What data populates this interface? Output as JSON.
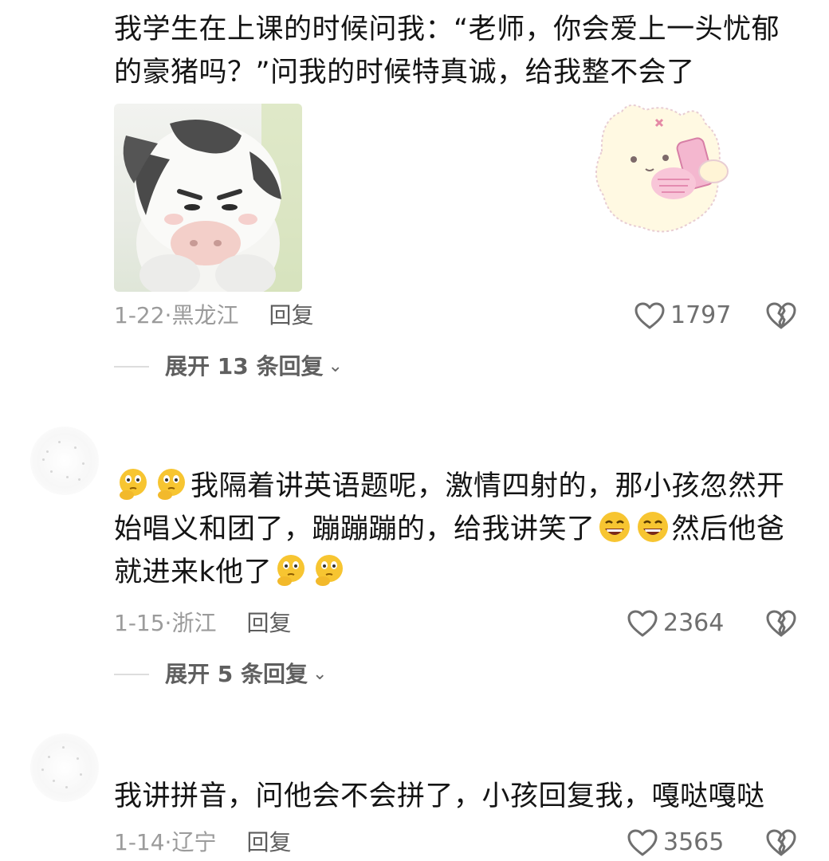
{
  "comments": [
    {
      "text": "我学生在上课的时候问我：“老师，你会爱上一头忧郁的豪猪吗？”问我的时候特真诚，给我整不会了",
      "date": "1-22",
      "location": "黑龙江",
      "reply_label": "回复",
      "likes": "1797",
      "expand_label": "展开 13 条回复"
    },
    {
      "text_seg1": "我隔着讲英语题呢，激情四射的，那小孩忽然开始唱义和团了，蹦蹦蹦的，给我讲笑了",
      "text_seg2": "然后他爸就进来k他了",
      "date": "1-15",
      "location": "浙江",
      "reply_label": "回复",
      "likes": "2364",
      "expand_label": "展开 5 条回复"
    },
    {
      "text": "我讲拼音，问他会不会拼了，小孩回复我，嘎哒嘎哒",
      "date": "1-14",
      "location": "辽宁",
      "reply_label": "回复",
      "likes": "3565"
    }
  ],
  "icons": {
    "like": "heart-outline-icon",
    "dislike": "broken-heart-icon",
    "expand": "chevron-down-icon",
    "emoji_think": "thinking-face-emoji-icon",
    "emoji_grin": "grinning-face-emoji-icon"
  },
  "colors": {
    "text": "#141414",
    "meta": "#9b9b9b",
    "reply": "#5c5c5c",
    "icon": "#6f6f6f",
    "emoji": "#f7c531"
  }
}
